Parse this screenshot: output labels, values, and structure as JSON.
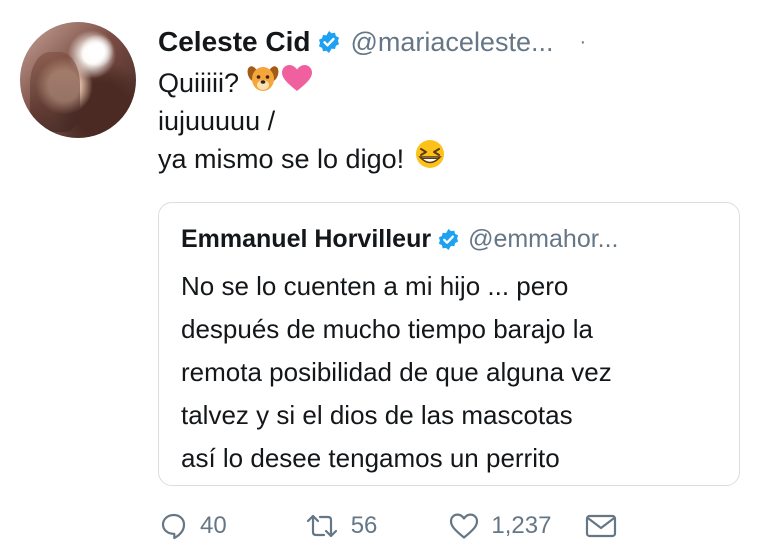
{
  "tweet": {
    "author_name": "Celeste Cid",
    "author_handle": "@mariaceleste...",
    "separator": "·",
    "lines": [
      "Quiiiii?",
      "iujuuuuu /",
      "ya mismo se lo digo!"
    ],
    "emoji": [
      "dog-face-icon",
      "pink-heart-icon",
      "grinning-squinting-face-icon"
    ]
  },
  "quote": {
    "author_name": "Emmanuel Horvilleur",
    "author_handle": "@emmahor...",
    "lines": [
      "No se lo cuenten a mi hijo ... pero",
      "después de mucho tiempo barajo la",
      "remota posibilidad de que alguna vez",
      "talvez  y si el dios de las mascotas",
      "así lo desee tengamos un perrito"
    ]
  },
  "actions": {
    "replies": "40",
    "retweets": "56",
    "likes": "1,237"
  },
  "colors": {
    "verified": "#1da1f2",
    "secondary_text": "#657786",
    "primary_text": "#14171a",
    "border": "#d8dee3"
  }
}
